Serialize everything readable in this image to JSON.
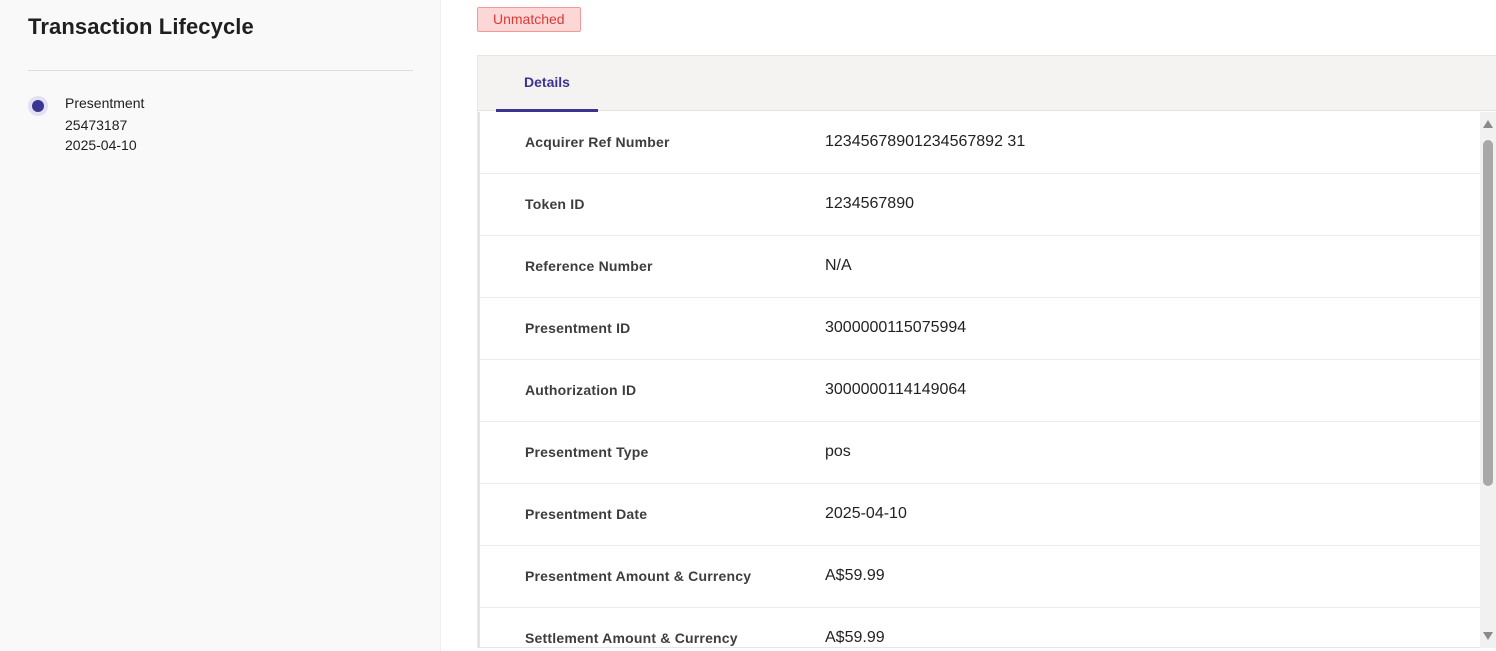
{
  "lifecycle": {
    "title": "Transaction Lifecycle",
    "items": [
      {
        "stage": "Presentment",
        "id": "25473187",
        "date": "2025-04-10"
      }
    ]
  },
  "status": {
    "label": "Unmatched",
    "color": "#d93a3a",
    "background": "#fdd6d6"
  },
  "tabs": [
    {
      "label": "Details",
      "active": true
    }
  ],
  "accent_color": "#3b3591",
  "details": [
    {
      "label": "Acquirer Ref Number",
      "value": "12345678901234567892 31"
    },
    {
      "label": "Token ID",
      "value": "1234567890"
    },
    {
      "label": "Reference Number",
      "value": "N/A"
    },
    {
      "label": "Presentment ID",
      "value": "3000000115075994"
    },
    {
      "label": "Authorization ID",
      "value": "3000000114149064"
    },
    {
      "label": "Presentment Type",
      "value": "pos"
    },
    {
      "label": "Presentment Date",
      "value": "2025-04-10"
    },
    {
      "label": "Presentment Amount & Currency",
      "value": "A$59.99"
    },
    {
      "label": "Settlement Amount & Currency",
      "value": "A$59.99"
    }
  ]
}
